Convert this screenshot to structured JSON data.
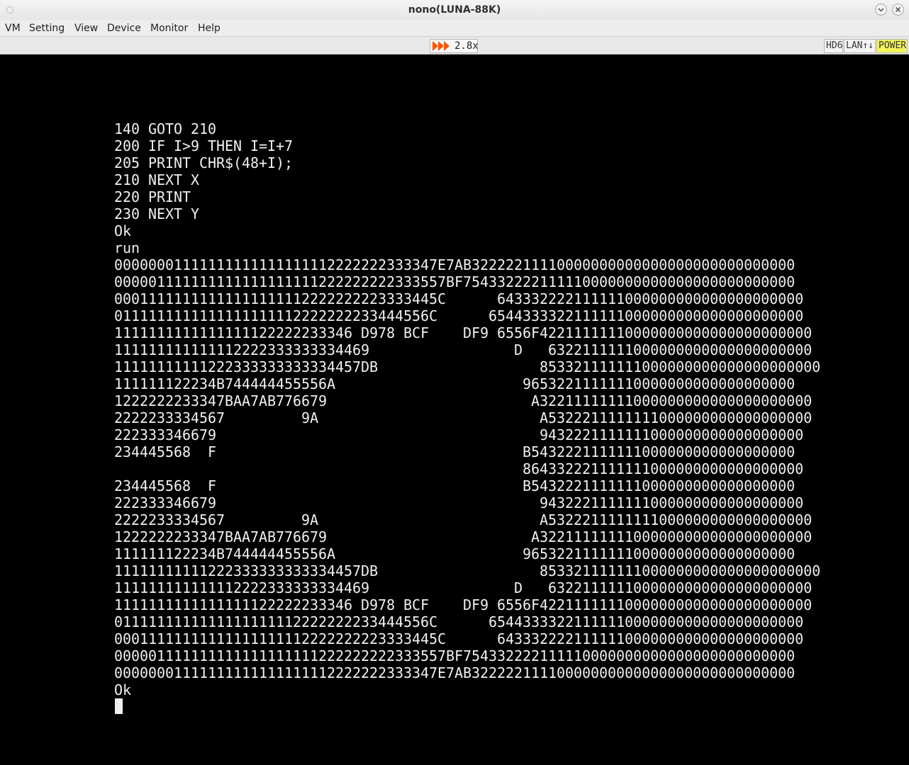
{
  "window": {
    "title": "nono(LUNA-88K)"
  },
  "menu": [
    "VM",
    "Setting",
    "View",
    "Device",
    "Monitor",
    "Help"
  ],
  "toolbar": {
    "speed_icon": "fast-forward-icon",
    "speed_label": "2.8x",
    "indicators": {
      "hd": "HD6",
      "lan": "LAN↑↓",
      "power": "POWER"
    },
    "colors": {
      "speed_icon": "#ff5500",
      "power_bg": "#f3f55a"
    }
  },
  "terminal": {
    "lines": [
      "140 GOTO 210",
      "200 IF I>9 THEN I=I+7",
      "205 PRINT CHR$(48+I);",
      "210 NEXT X",
      "220 PRINT",
      "230 NEXT Y",
      "Ok",
      "run",
      "00000001111111111111111112222222333347E7AB32222211110000000000000000000000000000",
      "000001111111111111111111222222222333557BF754332222111110000000000000000000000000",
      "00011111111111111111112222222223333445C      643332222111111000000000000000000000",
      "0111111111111111111112222222233444556C      6544333322111111000000000000000000000",
      "1111111111111111122222233346 D978 BCF    DF9 6556F42211111110000000000000000000000",
      "111111111111112222333333334469                 D   6322111111000000000000000000000",
      "11111111111222333333333334457DB                   853321111111000000000000000000000",
      "111111122234B744444455556A                      96532211111110000000000000000000",
      "1222222233347BAA7AB776679                        A32211111111000000000000000000000",
      "2222233334567         9A                          A5322211111111000000000000000000",
      "222333346679                                      9432221111111000000000000000000",
      "234445568  F                                    B5432221111111000000000000000000",
      "                                                864332221111111000000000000000000",
      "234445568  F                                    B5432221111111000000000000000000",
      "222333346679                                      9432221111111000000000000000000",
      "2222233334567         9A                          A5322211111111000000000000000000",
      "1222222233347BAA7AB776679                        A32211111111000000000000000000000",
      "111111122234B744444455556A                      96532211111110000000000000000000",
      "11111111111222333333333334457DB                   853321111111000000000000000000000",
      "111111111111112222333333334469                 D   6322111111000000000000000000000",
      "1111111111111111122222233346 D978 BCF    DF9 6556F42211111110000000000000000000000",
      "0111111111111111111112222222233444556C      6544333322111111000000000000000000000",
      "00011111111111111111112222222223333445C      643332222111111000000000000000000000",
      "000001111111111111111111222222222333557BF754332222111110000000000000000000000000",
      "00000001111111111111111112222222333347E7AB32222211110000000000000000000000000000",
      "Ok"
    ]
  }
}
